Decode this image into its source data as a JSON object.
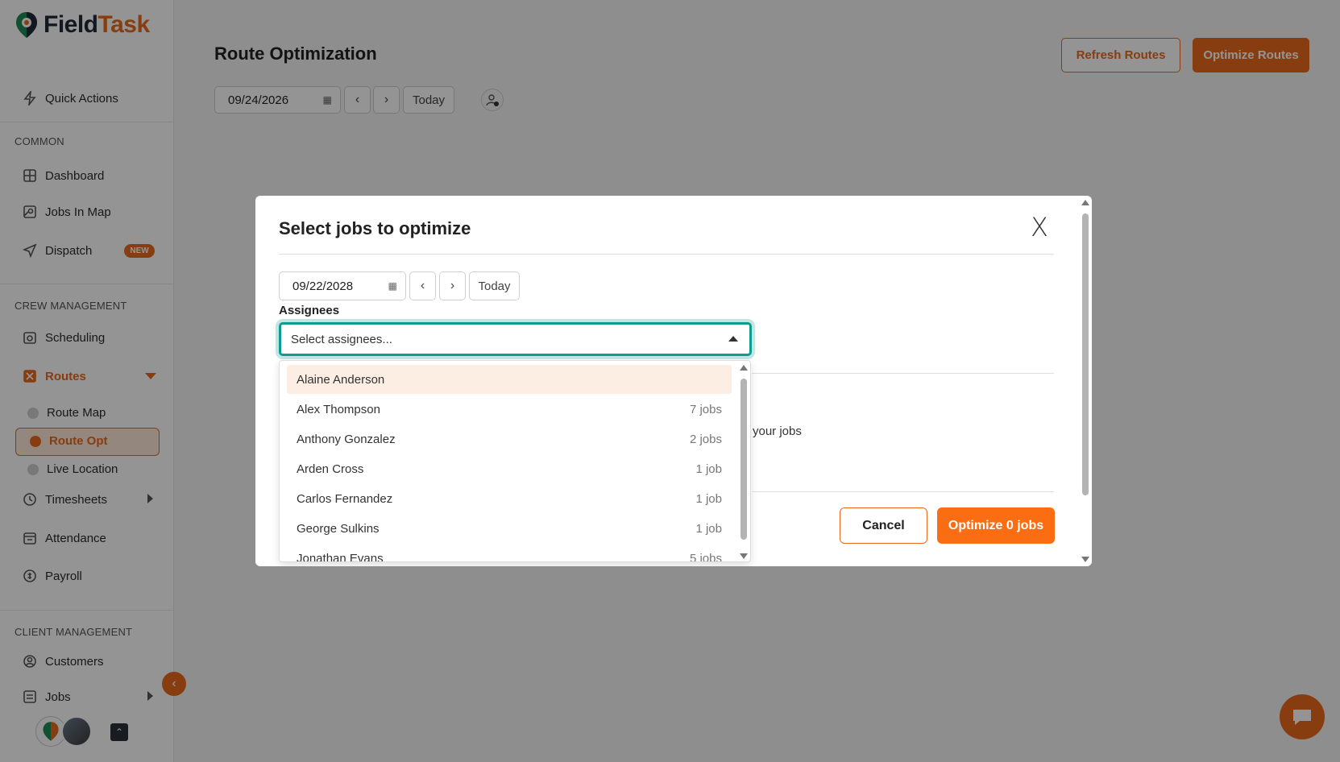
{
  "brand": {
    "name_part1": "Field",
    "name_part2": "Task",
    "accent": "#ea6a1c"
  },
  "sidebar": {
    "quick_actions": "Quick Actions",
    "common_label": "COMMON",
    "dashboard": "Dashboard",
    "jobs_in_map": "Jobs In Map",
    "dispatch": "Dispatch",
    "dispatch_badge": "NEW",
    "crew_label": "CREW MANAGEMENT",
    "scheduling": "Scheduling",
    "routes": "Routes",
    "route_map": "Route Map",
    "route_opt": "Route Opt",
    "live_location": "Live Location",
    "timesheets": "Timesheets",
    "attendance": "Attendance",
    "payroll": "Payroll",
    "client_label": "CLIENT MANAGEMENT",
    "customers": "Customers",
    "jobs": "Jobs"
  },
  "header": {
    "title": "Route Optimization",
    "refresh_button": "Refresh Routes",
    "optimize_button": "Optimize Routes",
    "date": "09/24/2026",
    "today": "Today"
  },
  "modal": {
    "title": "Select jobs to optimize",
    "close": "X",
    "date": "09/22/2028",
    "today": "Today",
    "assignees_label": "Assignees",
    "select_placeholder": "Select assignees...",
    "behind_text": "your jobs",
    "cancel": "Cancel",
    "optimize": "Optimize 0 jobs"
  },
  "assignees": [
    {
      "name": "Alaine Anderson",
      "count": ""
    },
    {
      "name": "Alex Thompson",
      "count": "7 jobs"
    },
    {
      "name": "Anthony Gonzalez",
      "count": "2 jobs"
    },
    {
      "name": "Arden Cross",
      "count": "1 job"
    },
    {
      "name": "Carlos Fernandez",
      "count": "1 job"
    },
    {
      "name": "George Sulkins",
      "count": "1 job"
    },
    {
      "name": "Jonathan Evans",
      "count": "5 jobs"
    }
  ]
}
